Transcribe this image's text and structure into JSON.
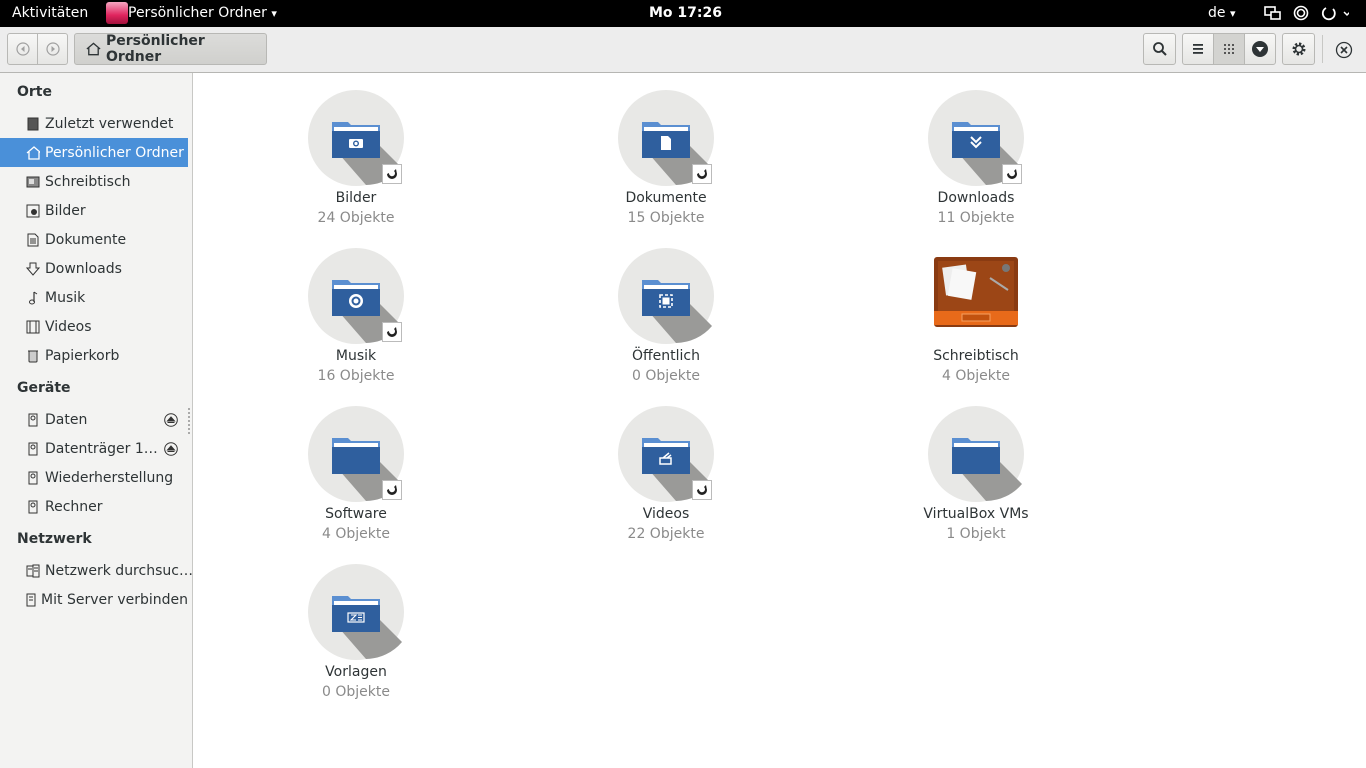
{
  "topbar": {
    "activities": "Aktivitäten",
    "app_name": "Persönlicher Ordner",
    "app_menu_arrow": "▾",
    "clock": "Mo 17:26",
    "language": "de",
    "language_arrow": "▾"
  },
  "headerbar": {
    "path_label": "Persönlicher Ordner"
  },
  "sidebar": {
    "sections": [
      {
        "heading": "Orte",
        "items": [
          {
            "label": "Zuletzt verwendet",
            "icon": "recent-icon"
          },
          {
            "label": "Persönlicher Ordner",
            "icon": "home-icon",
            "selected": true
          },
          {
            "label": "Schreibtisch",
            "icon": "desktop-icon"
          },
          {
            "label": "Bilder",
            "icon": "pictures-icon"
          },
          {
            "label": "Dokumente",
            "icon": "documents-icon"
          },
          {
            "label": "Downloads",
            "icon": "downloads-icon"
          },
          {
            "label": "Musik",
            "icon": "music-icon"
          },
          {
            "label": "Videos",
            "icon": "videos-icon"
          },
          {
            "label": "Papierkorb",
            "icon": "trash-icon"
          }
        ]
      },
      {
        "heading": "Geräte",
        "items": [
          {
            "label": "Daten",
            "icon": "drive-icon",
            "eject": true
          },
          {
            "label": "Datenträger 1…",
            "icon": "drive-icon",
            "eject": true
          },
          {
            "label": "Wiederherstellung",
            "icon": "drive-icon"
          },
          {
            "label": "Rechner",
            "icon": "drive-icon"
          }
        ]
      },
      {
        "heading": "Netzwerk",
        "items": [
          {
            "label": "Netzwerk durchsuc…",
            "icon": "network-icon"
          },
          {
            "label": "Mit Server verbinden",
            "icon": "server-icon"
          }
        ]
      }
    ]
  },
  "folders": [
    {
      "name": "Bilder",
      "count": "24 Objekte",
      "glyph": "camera",
      "link": true
    },
    {
      "name": "Dokumente",
      "count": "15 Objekte",
      "glyph": "document",
      "link": true
    },
    {
      "name": "Downloads",
      "count": "11 Objekte",
      "glyph": "download",
      "link": true
    },
    {
      "name": "Musik",
      "count": "16 Objekte",
      "glyph": "music",
      "link": true
    },
    {
      "name": "Öffentlich",
      "count": "0 Objekte",
      "glyph": "public",
      "link": false
    },
    {
      "name": "Schreibtisch",
      "count": "4 Objekte",
      "glyph": "desktop",
      "link": false
    },
    {
      "name": "Software",
      "count": "4 Objekte",
      "glyph": "none",
      "link": true
    },
    {
      "name": "Videos",
      "count": "22 Objekte",
      "glyph": "video",
      "link": true
    },
    {
      "name": "VirtualBox VMs",
      "count": "1 Objekt",
      "glyph": "none",
      "link": false
    },
    {
      "name": "Vorlagen",
      "count": "0 Objekte",
      "glyph": "template",
      "link": false
    }
  ],
  "colors": {
    "selection": "#4a90d9",
    "folder_blue": "#2f5f9e",
    "folder_tab": "#5b8fd1",
    "icon_circle": "#e8e8e6",
    "icon_shadow": "#9a9a98"
  }
}
